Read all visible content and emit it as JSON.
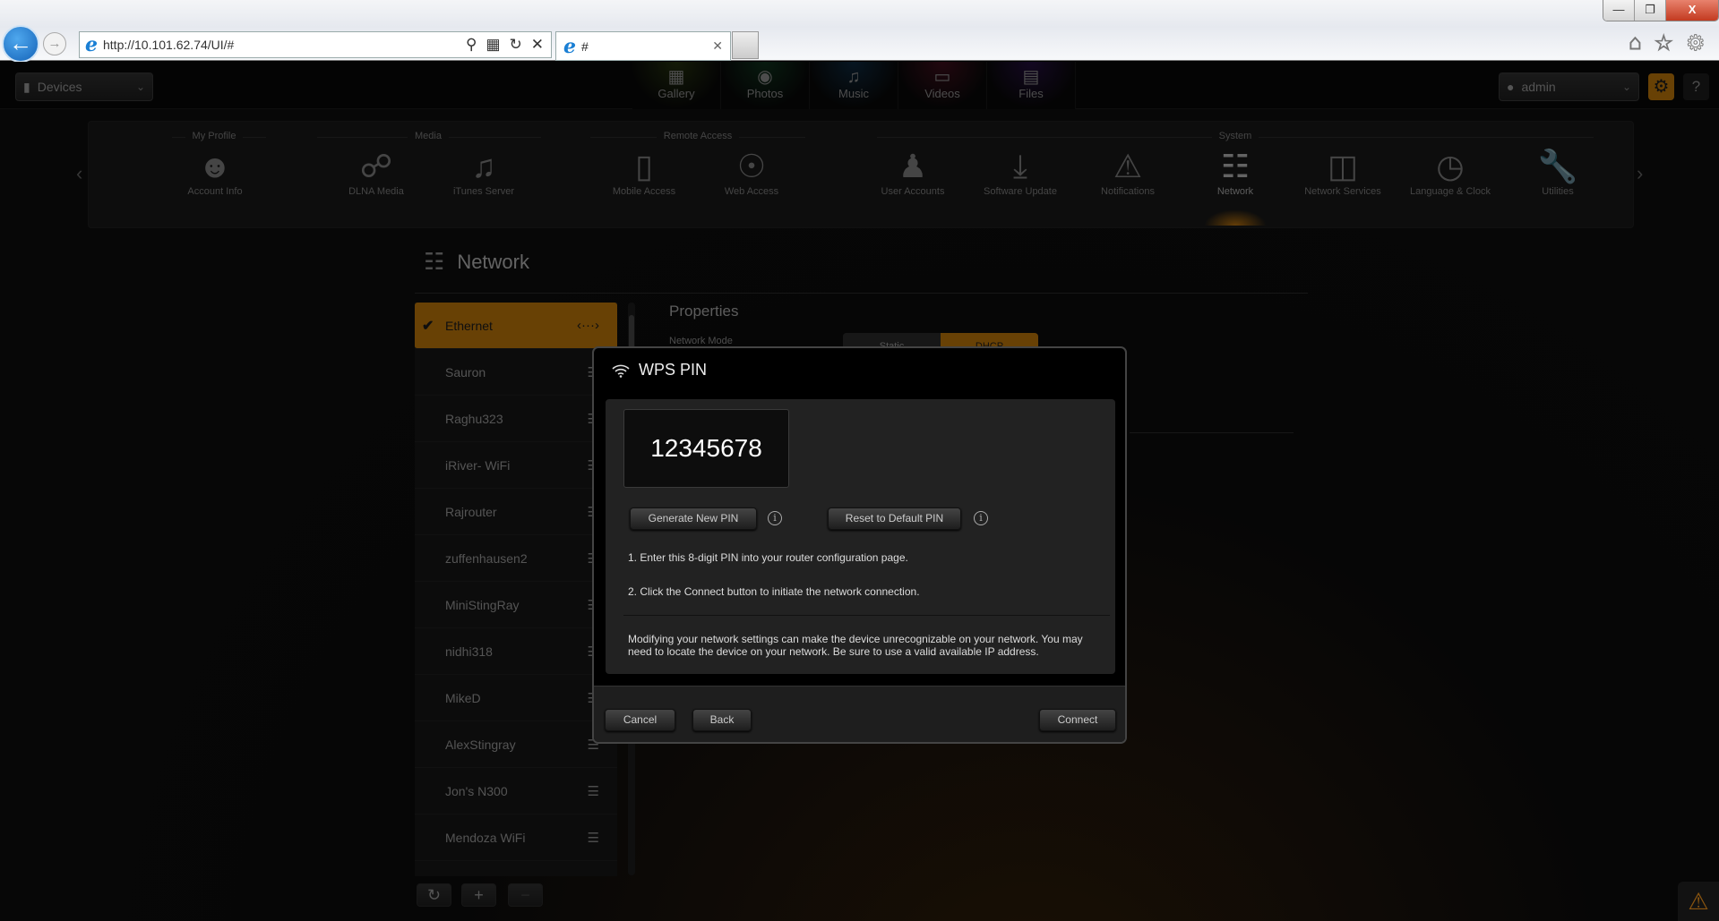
{
  "browser": {
    "url": "http://10.101.62.74/UI/#",
    "tab_title": "#",
    "window_controls": {
      "minimize": "minimize-icon",
      "restore": "restore-icon",
      "close": "close-icon"
    },
    "toolbar_icons": [
      "home-icon",
      "favorites-star-icon",
      "tools-gear-icon"
    ]
  },
  "header": {
    "device_dropdown": "Devices",
    "media_tabs": [
      {
        "label": "Gallery",
        "icon": "gallery-icon"
      },
      {
        "label": "Photos",
        "icon": "camera-icon"
      },
      {
        "label": "Music",
        "icon": "music-note-icon"
      },
      {
        "label": "Videos",
        "icon": "video-camera-icon"
      },
      {
        "label": "Files",
        "icon": "file-icon"
      }
    ],
    "user_dropdown": "admin",
    "help_label": "?"
  },
  "settings_panel": {
    "groups": [
      "My Profile",
      "Media",
      "Remote Access",
      "System"
    ],
    "items": [
      {
        "label": "Account Info",
        "icon": "account-card-icon"
      },
      {
        "label": "DLNA Media",
        "icon": "dlna-icon"
      },
      {
        "label": "iTunes Server",
        "icon": "itunes-icon"
      },
      {
        "label": "Mobile Access",
        "icon": "mobile-phone-icon"
      },
      {
        "label": "Web Access",
        "icon": "globe-icon"
      },
      {
        "label": "User Accounts",
        "icon": "users-icon"
      },
      {
        "label": "Software Update",
        "icon": "download-tray-icon"
      },
      {
        "label": "Notifications",
        "icon": "warning-triangle-icon"
      },
      {
        "label": "Network",
        "icon": "network-tree-icon",
        "active": true
      },
      {
        "label": "Network Services",
        "icon": "network-services-icon"
      },
      {
        "label": "Language & Clock",
        "icon": "globe-clock-icon"
      },
      {
        "label": "Utilities",
        "icon": "wrench-icon"
      }
    ]
  },
  "network_page": {
    "title": "Network",
    "networks": [
      {
        "name": "Ethernet",
        "selected": true
      },
      {
        "name": "Sauron"
      },
      {
        "name": "Raghu323"
      },
      {
        "name": "iRiver- WiFi"
      },
      {
        "name": "Rajrouter"
      },
      {
        "name": "zuffenhausen2"
      },
      {
        "name": "MiniStingRay"
      },
      {
        "name": "nidhi318"
      },
      {
        "name": "MikeD"
      },
      {
        "name": "AlexStingray"
      },
      {
        "name": "Jon's N300"
      },
      {
        "name": "Mendoza WiFi"
      }
    ],
    "properties_title": "Properties",
    "network_mode_label": "Network Mode",
    "network_mode_options": [
      "Static",
      "DHCP"
    ],
    "network_mode_selected": "DHCP"
  },
  "modal": {
    "title": "WPS PIN",
    "pin": "12345678",
    "generate_button": "Generate New PIN",
    "reset_button": "Reset to Default PIN",
    "step1": "1. Enter this 8-digit PIN into your router configuration page.",
    "step2": "2. Click the Connect button to initiate the network connection.",
    "warning": "Modifying your network settings can make the device unrecognizable on your network. You may need to locate the device on your network. Be sure to use a valid available IP address.",
    "cancel_button": "Cancel",
    "back_button": "Back",
    "connect_button": "Connect"
  },
  "colors": {
    "accent": "#e8900c",
    "modal_bg": "#000000",
    "panel_bg": "#222222"
  }
}
